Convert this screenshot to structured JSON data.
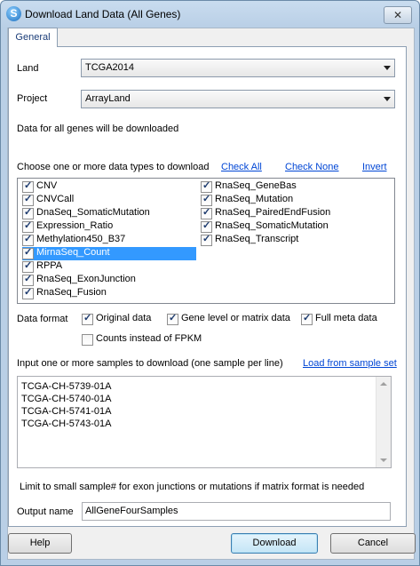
{
  "window": {
    "title": "Download Land Data (All Genes)",
    "close_glyph": "✕",
    "icon_letter": "S"
  },
  "tabs": [
    {
      "label": "General"
    }
  ],
  "form": {
    "land_label": "Land",
    "land_value": "TCGA2014",
    "project_label": "Project",
    "project_value": "ArrayLand",
    "info_text": "Data for all genes will be downloaded",
    "datatype_prompt": "Choose one or more data types to download",
    "check_all": "Check All",
    "check_none": "Check None",
    "invert": "Invert",
    "data_types_left": [
      {
        "label": "CNV",
        "checked": true
      },
      {
        "label": "CNVCall",
        "checked": true
      },
      {
        "label": "DnaSeq_SomaticMutation",
        "checked": true
      },
      {
        "label": "Expression_Ratio",
        "checked": true
      },
      {
        "label": "Methylation450_B37",
        "checked": true
      },
      {
        "label": "MirnaSeq_Count",
        "checked": true,
        "selected": true
      },
      {
        "label": "RPPA",
        "checked": true
      },
      {
        "label": "RnaSeq_ExonJunction",
        "checked": true
      },
      {
        "label": "RnaSeq_Fusion",
        "checked": true
      }
    ],
    "data_types_right": [
      {
        "label": "RnaSeq_GeneBas",
        "checked": true
      },
      {
        "label": "RnaSeq_Mutation",
        "checked": true
      },
      {
        "label": "RnaSeq_PairedEndFusion",
        "checked": true
      },
      {
        "label": "RnaSeq_SomaticMutation",
        "checked": true
      },
      {
        "label": "RnaSeq_Transcript",
        "checked": true
      }
    ],
    "data_format_label": "Data format",
    "format_options": [
      {
        "label": "Original data",
        "checked": true
      },
      {
        "label": "Gene level or matrix data",
        "checked": true
      },
      {
        "label": "Full meta data",
        "checked": true
      }
    ],
    "counts_option": {
      "label": "Counts instead of FPKM",
      "checked": false
    },
    "samples_prompt": "Input one or more samples to download (one sample per line)",
    "load_sample_set": "Load from sample set",
    "samples": [
      "TCGA-CH-5739-01A",
      "TCGA-CH-5740-01A",
      "TCGA-CH-5741-01A",
      "TCGA-CH-5743-01A"
    ],
    "limit_note": "Limit to small sample# for exon junctions or mutations if matrix format is needed",
    "output_name_label": "Output name",
    "output_name_value": "AllGeneFourSamples"
  },
  "buttons": {
    "help": "Help",
    "download": "Download",
    "cancel": "Cancel"
  }
}
